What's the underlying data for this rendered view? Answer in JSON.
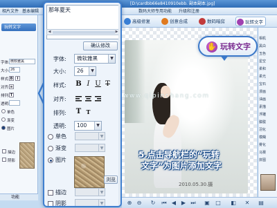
{
  "window": {
    "title_fragment": "[D:\\cardbb66e8410910ebb. 副本副本.jpg]",
    "menu": [
      "相片文件",
      "基本编辑",
      "数码大师专用功能",
      "升级和注册"
    ]
  },
  "nav": {
    "tabs": [
      {
        "label": "高级修复",
        "color": "#3a7fd5"
      },
      {
        "label": "创意合成",
        "color": "#e07a1f"
      },
      {
        "label": "数码暗房",
        "color": "#c23a3a"
      },
      {
        "label": "玩转文字",
        "color": "#a040b0"
      }
    ],
    "callout_label": "玩转文字"
  },
  "left_strip": {
    "tab": "玩转文字",
    "rows": [
      "字体:",
      "大小:",
      "样式:",
      "对齐:",
      "排列:",
      "透明:",
      "单色",
      "渐变",
      "图片",
      "描边",
      "阴影"
    ],
    "font_value": "微软雅黑",
    "size_value": "26",
    "footer": "功能"
  },
  "panel": {
    "text_value": "那年夏天",
    "confirm_button": "确认修改",
    "font_label": "字体:",
    "font_value": "微软雅黑",
    "size_label": "大小:",
    "size_value": "26",
    "style_label": "样式:",
    "style_buttons": [
      "B",
      "I",
      "U",
      "T"
    ],
    "align_label": "对齐:",
    "arrange_label": "排列:",
    "arrange_buttons": [
      "T",
      "T"
    ],
    "opacity_label": "透明:",
    "opacity_value": "100",
    "fill_options": [
      {
        "label": "单色",
        "selected": false
      },
      {
        "label": "渐变",
        "selected": false
      },
      {
        "label": "图片",
        "selected": true
      }
    ],
    "browse_button": "浏览",
    "stroke_label": "描边",
    "shadow_label": "阴影"
  },
  "canvas": {
    "caption_line1": "5.点击导航栏的“玩转",
    "caption_line2": "文字”为图片添加文字",
    "date": "2010.05.30.摄",
    "watermark": "www.qipinchang.com"
  },
  "right_strip": {
    "labels": [
      "相机",
      "黑白",
      "玉色",
      "星空",
      "柔和",
      "柔光",
      "宝石",
      "漫画",
      "油画",
      "素描",
      "浮雕",
      "朦胧",
      "羽化",
      "模糊",
      "雾化",
      "马赛",
      "拼图"
    ]
  }
}
